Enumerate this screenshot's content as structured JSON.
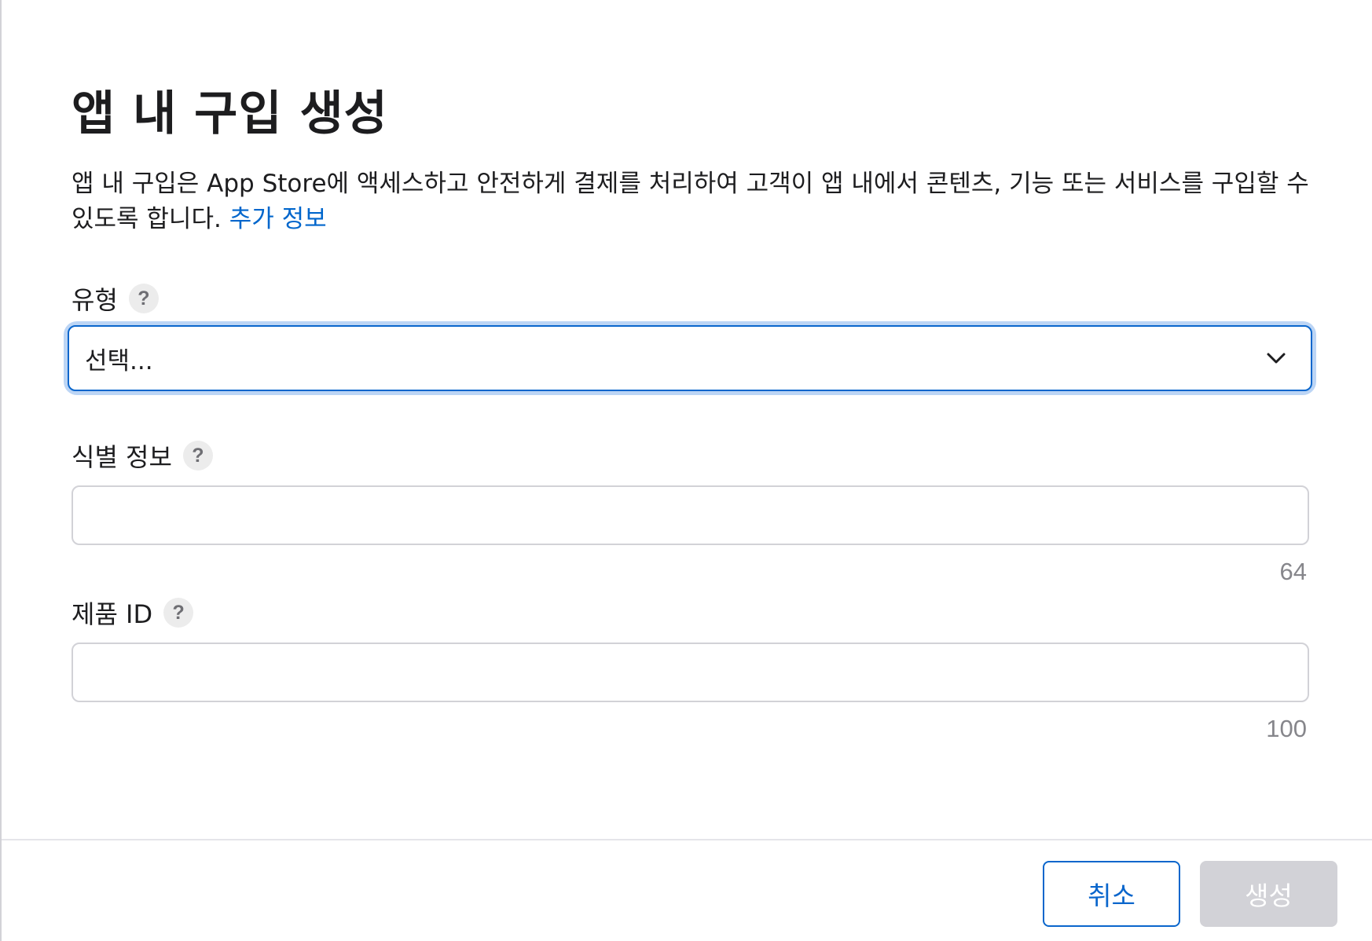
{
  "dialog": {
    "title": "앱 내 구입 생성",
    "description": "앱 내 구입은 App Store에 액세스하고 안전하게 결제를 처리하여 고객이 앱 내에서 콘텐츠, 기능 또는 서비스를 구입할 수 있도록 합니다.",
    "learn_more_link": "추가 정보"
  },
  "fields": {
    "type": {
      "label": "유형",
      "help": "?",
      "selected": "선택..."
    },
    "reference_name": {
      "label": "식별 정보",
      "help": "?",
      "value": "",
      "max_length": "64"
    },
    "product_id": {
      "label": "제품 ID",
      "help": "?",
      "value": "",
      "max_length": "100"
    }
  },
  "footer": {
    "cancel_label": "취소",
    "create_label": "생성"
  },
  "colors": {
    "accent": "#0a66cc",
    "focus_ring": "#bcd5f5",
    "disabled_button": "#d2d2d7",
    "muted_text": "#86868b"
  }
}
